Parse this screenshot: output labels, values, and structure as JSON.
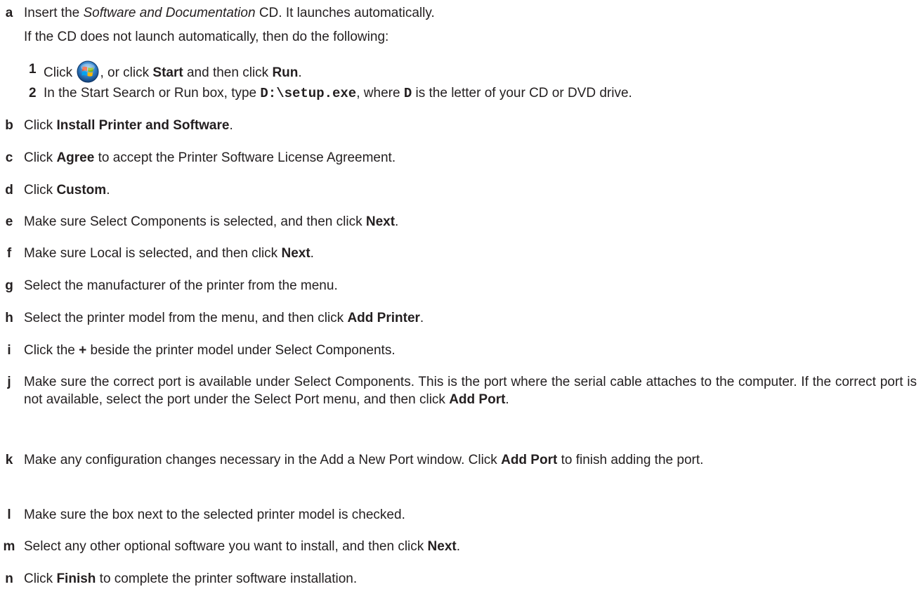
{
  "steps": {
    "a": {
      "letter": "a",
      "pre": "Insert the ",
      "em": "Software and Documentation",
      "post": " CD. It launches automatically.",
      "line2": "If the CD does not launch automatically, then do the following:",
      "sub1": {
        "num": "1",
        "t1": "Click ",
        "t2": ", or click ",
        "b1": "Start",
        "t3": " and then click ",
        "b2": "Run",
        "t4": "."
      },
      "sub2": {
        "num": "2",
        "t1": "In the Start Search or Run box, type ",
        "code1": "D:\\setup.exe",
        "t2": ", where ",
        "code2": "D",
        "t3": " is the letter of your CD or DVD drive."
      }
    },
    "b": {
      "letter": "b",
      "t1": "Click ",
      "b1": "Install Printer and Software",
      "t2": "."
    },
    "c": {
      "letter": "c",
      "t1": "Click ",
      "b1": "Agree",
      "t2": " to accept the Printer Software License Agreement."
    },
    "d": {
      "letter": "d",
      "t1": "Click ",
      "b1": "Custom",
      "t2": "."
    },
    "e": {
      "letter": "e",
      "t1": "Make sure Select Components is selected, and then click ",
      "b1": "Next",
      "t2": "."
    },
    "f": {
      "letter": "f",
      "t1": "Make sure Local is selected, and then click ",
      "b1": "Next",
      "t2": "."
    },
    "g": {
      "letter": "g",
      "t1": "Select the manufacturer of the printer from the menu."
    },
    "h": {
      "letter": "h",
      "t1": "Select the printer model from the menu, and then click ",
      "b1": "Add Printer",
      "t2": "."
    },
    "i": {
      "letter": "i",
      "t1": "Click the ",
      "b1": "+",
      "t2": " beside the printer model under Select Components."
    },
    "j": {
      "letter": "j",
      "t1": "Make sure the correct port is available under Select Components. This is the port where the serial cable attaches to the computer. If the correct port is not available, select the port under the Select Port menu, and then click ",
      "b1": "Add Port",
      "t2": "."
    },
    "k": {
      "letter": "k",
      "t1": "Make any configuration changes necessary in the Add a New Port window. Click ",
      "b1": "Add Port",
      "t2": " to finish adding the port."
    },
    "l": {
      "letter": "l",
      "t1": "Make sure the box next to the selected printer model is checked."
    },
    "m": {
      "letter": "m",
      "t1": "Select any other optional software you want to install, and then click ",
      "b1": "Next",
      "t2": "."
    },
    "n": {
      "letter": "n",
      "t1": "Click ",
      "b1": "Finish",
      "t2": " to complete the printer software installation."
    }
  }
}
